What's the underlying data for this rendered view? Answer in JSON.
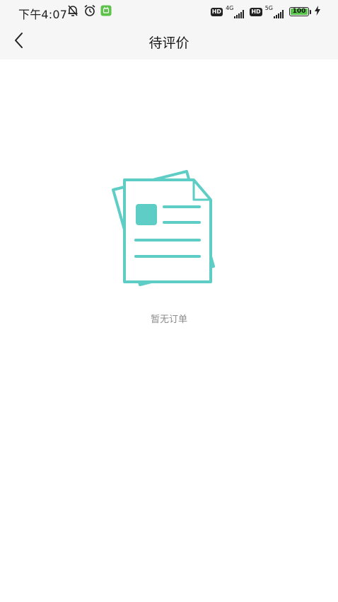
{
  "status_bar": {
    "time": "下午4:07",
    "icons": [
      "silent-bell-icon",
      "alarm-clock-icon",
      "notification-app-icon"
    ],
    "hd_label": "HD",
    "network_1": "4G",
    "network_2": "5G",
    "battery_level": "100",
    "battery_color": "#57c44a"
  },
  "nav": {
    "title": "待评价",
    "back_icon": "chevron-left-icon"
  },
  "empty_state": {
    "icon": "document-stack-icon",
    "accent_color": "#5ecdc5",
    "message": "暂无订单"
  }
}
